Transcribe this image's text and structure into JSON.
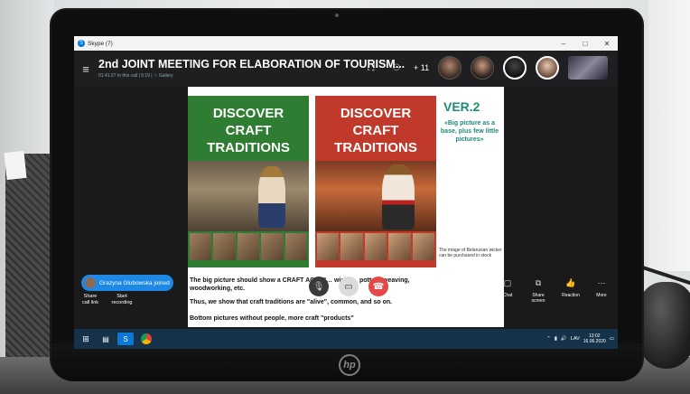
{
  "window": {
    "title": "Skype (7)"
  },
  "call": {
    "title": "2nd JOINT MEETING FOR ELABORATION OF TOURISM...",
    "subtitle": "01:41:27 In this call | 5:19 | ☆ Gallery",
    "participants_extra": "+ 11"
  },
  "slide": {
    "panel_left_heading": "DISCOVER\nCRAFT\nTRADITIONS",
    "panel_right_heading": "DISCOVER\nCRAFT\nTRADITIONS",
    "version": "VER.2",
    "version_note": "«Big picture as a base, plus few little pictures»",
    "image_caption": "The image of Belarusian wicker can be purchased in stock",
    "line1": "The big picture should show a CRAFT ACTIVI… wicke… potte… weaving, woodworking, etc.",
    "line2": "Thus, we show that craft traditions are \"alive\", common, and so on.",
    "line3": "Bottom pictures without people, more craft \"products\""
  },
  "notification": {
    "text": "Grazyna Glubowska joined"
  },
  "left_actions": [
    {
      "label": "Share call link"
    },
    {
      "label": "Start recording"
    }
  ],
  "right_actions": [
    {
      "label": "Chat",
      "icon": "chat-icon"
    },
    {
      "label": "Share screen",
      "icon": "share-screen-icon"
    },
    {
      "label": "Reaction",
      "icon": "thumbs-up-icon"
    },
    {
      "label": "More",
      "icon": "more-icon"
    }
  ],
  "controls": {
    "mic": "mute",
    "video": "video",
    "hangup": "hang-up"
  },
  "taskbar": {
    "language": "LAV",
    "time": "13:02",
    "date": "16.06.2020"
  },
  "hardware": {
    "brand": "hp"
  }
}
